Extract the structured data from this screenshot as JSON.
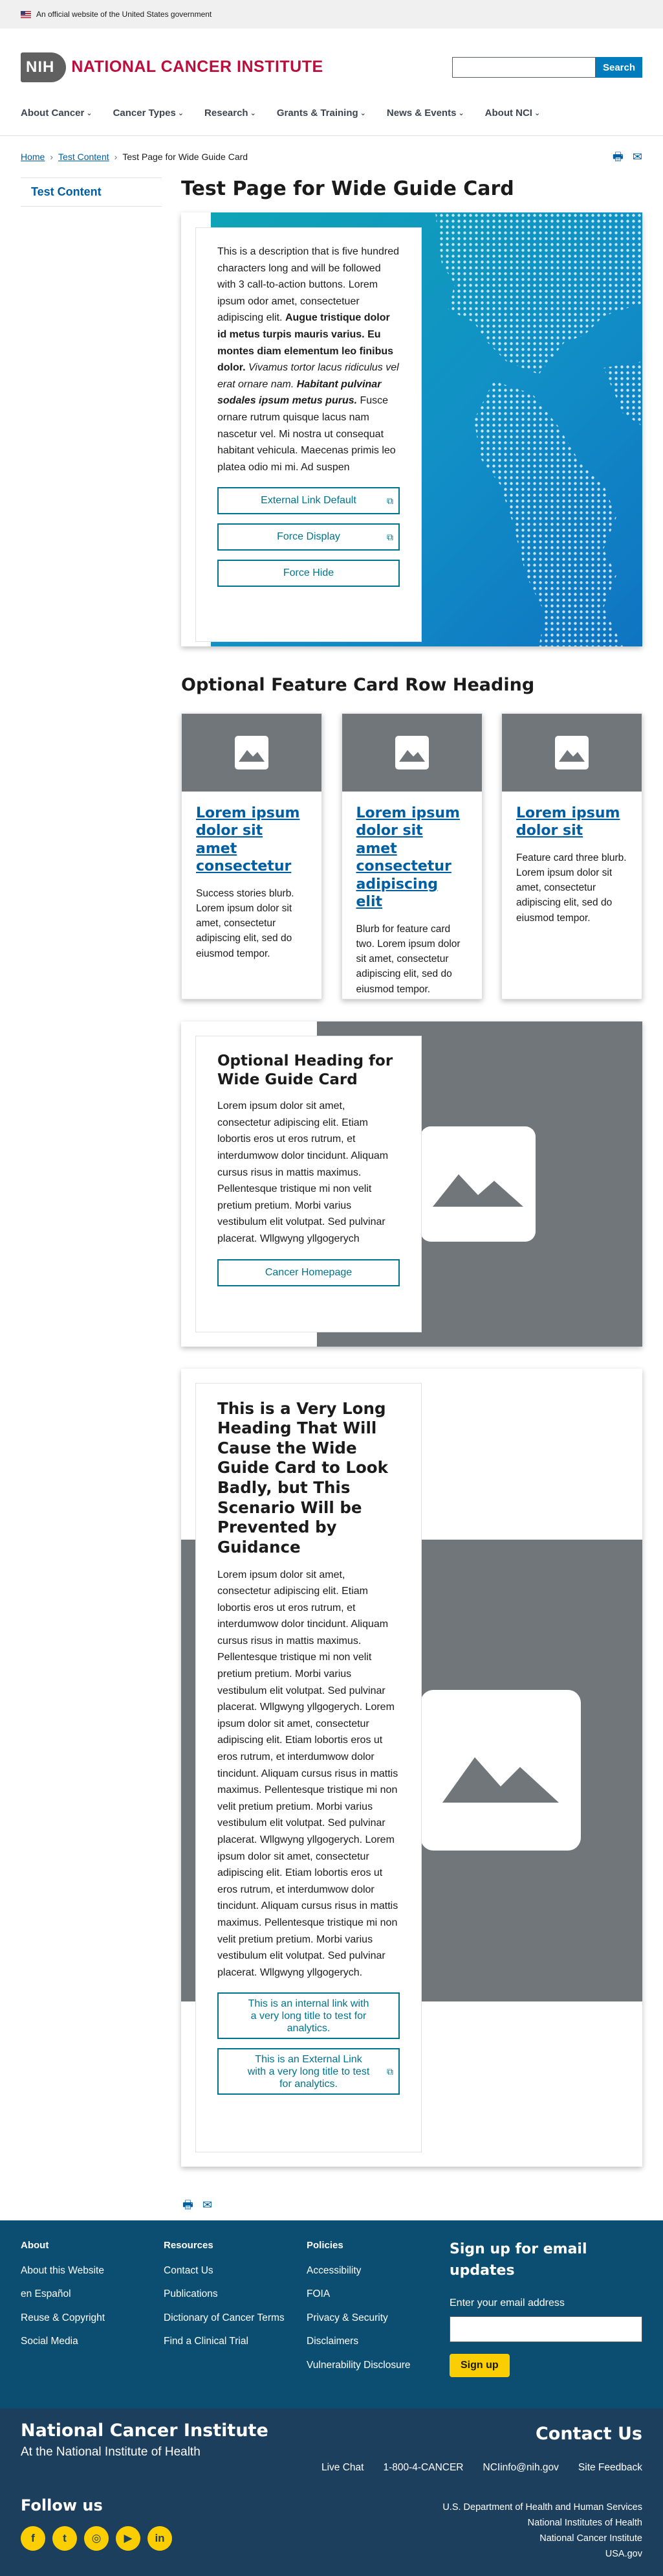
{
  "gov_banner": {
    "text": "An official website of the United States government"
  },
  "header": {
    "nih": "NIH",
    "nci_name": "NATIONAL CANCER INSTITUTE",
    "search_placeholder": "",
    "search_button": "Search"
  },
  "nav": [
    {
      "label": "About Cancer"
    },
    {
      "label": "Cancer Types"
    },
    {
      "label": "Research"
    },
    {
      "label": "Grants & Training"
    },
    {
      "label": "News & Events"
    },
    {
      "label": "About NCI"
    }
  ],
  "breadcrumb": {
    "home": "Home",
    "parent": "Test Content",
    "current": "Test Page for Wide Guide Card"
  },
  "sidebar": {
    "link": "Test Content"
  },
  "page_title": "Test Page for Wide Guide Card",
  "card1": {
    "desc_a": "This is a description that is five hundred characters long and will be followed with 3 call-to-action buttons. Lorem ipsum odor amet, consectetuer adipiscing elit. ",
    "desc_bold": "Augue tristique dolor id metus turpis mauris varius. Eu montes diam elementum leo finibus dolor.",
    "desc_italic": " Vivamus tortor lacus ridiculus vel erat ornare nam. ",
    "desc_bold_italic": "Habitant pulvinar sodales ipsum metus purus.",
    "desc_b": " Fusce ornare rutrum quisque lacus nam nascetur vel. Mi nostra ut consequat habitant vehicula. Maecenas primis leo platea odio mi mi. Ad suspen",
    "buttons": [
      "External Link Default",
      "Force Display",
      "Force Hide"
    ]
  },
  "feature_heading": "Optional Feature Card Row Heading",
  "features": [
    {
      "title": "Lorem ipsum dolor sit amet consectetur",
      "text": "Success stories blurb. Lorem ipsum dolor sit amet, consectetur adipiscing elit, sed do eiusmod tempor."
    },
    {
      "title": "Lorem ipsum dolor sit amet consectetur adipiscing elit",
      "text": "Blurb for feature card two. Lorem ipsum dolor sit amet, consectetur adipiscing elit, sed do eiusmod tempor."
    },
    {
      "title": "Lorem ipsum dolor sit",
      "text": "Feature card three blurb. Lorem ipsum dolor sit amet, consectetur adipiscing elit, sed do eiusmod tempor."
    }
  ],
  "card2": {
    "title": "Optional Heading for Wide Guide Card",
    "body": "Lorem ipsum dolor sit amet, consectetur adipiscing elit. Etiam lobortis eros ut eros rutrum, et interdumwow dolor tincidunt. Aliquam cursus risus in mattis maximus. Pellentesque tristique mi non velit pretium pretium. Morbi varius vestibulum elit volutpat. Sed pulvinar placerat. Wllgwyng yllgogerych",
    "button": "Cancer Homepage"
  },
  "card3": {
    "title": "This is a Very Long Heading That Will Cause the Wide Guide Card to Look Badly, but This Scenario Will be Prevented by Guidance",
    "body": "Lorem ipsum dolor sit amet, consectetur adipiscing elit. Etiam lobortis eros ut eros rutrum, et interdumwow dolor tincidunt. Aliquam cursus risus in mattis maximus. Pellentesque tristique mi non velit pretium pretium. Morbi varius vestibulum elit volutpat. Sed pulvinar placerat. Wllgwyng yllgogerych. Lorem ipsum dolor sit amet, consectetur adipiscing elit. Etiam lobortis eros ut eros rutrum, et interdumwow dolor tincidunt. Aliquam cursus risus in mattis maximus. Pellentesque tristique mi non velit pretium pretium. Morbi varius vestibulum elit volutpat. Sed pulvinar placerat. Wllgwyng yllgogerych. Lorem ipsum dolor sit amet, consectetur adipiscing elit. Etiam lobortis eros ut eros rutrum, et interdumwow dolor tincidunt. Aliquam cursus risus in mattis maximus. Pellentesque tristique mi non velit pretium pretium. Morbi varius vestibulum elit volutpat. Sed pulvinar placerat. Wllgwyng yllgogerych.",
    "button_internal": "This is an internal link with a very long title to test for analytics.",
    "button_external": "This is an External Link with a very long title to test for analytics."
  },
  "footer": {
    "about": {
      "heading": "About",
      "links": [
        "About this Website",
        "en Español",
        "Reuse & Copyright",
        "Social Media"
      ]
    },
    "resources": {
      "heading": "Resources",
      "links": [
        "Contact Us",
        "Publications",
        "Dictionary of Cancer Terms",
        "Find a Clinical Trial"
      ]
    },
    "policies": {
      "heading": "Policies",
      "links": [
        "Accessibility",
        "FOIA",
        "Privacy & Security",
        "Disclaimers",
        "Vulnerability Disclosure"
      ]
    },
    "signup": {
      "heading": "Sign up for email updates",
      "label": "Enter your email address",
      "button": "Sign up"
    },
    "org_name": "National Cancer Institute",
    "org_sub": "At the National Institute of Health",
    "contact_heading": "Contact Us",
    "contact_links": [
      "Live Chat",
      "1-800-4-CANCER",
      "NCIinfo@nih.gov",
      "Site Feedback"
    ],
    "follow_heading": "Follow us",
    "social_icons": [
      "facebook-icon",
      "twitter-icon",
      "instagram-icon",
      "youtube-icon",
      "linkedin-icon"
    ],
    "agencies": [
      "U.S. Department of Health and Human Services",
      "National Institutes of Health",
      "National Cancer Institute",
      "USA.gov"
    ]
  }
}
